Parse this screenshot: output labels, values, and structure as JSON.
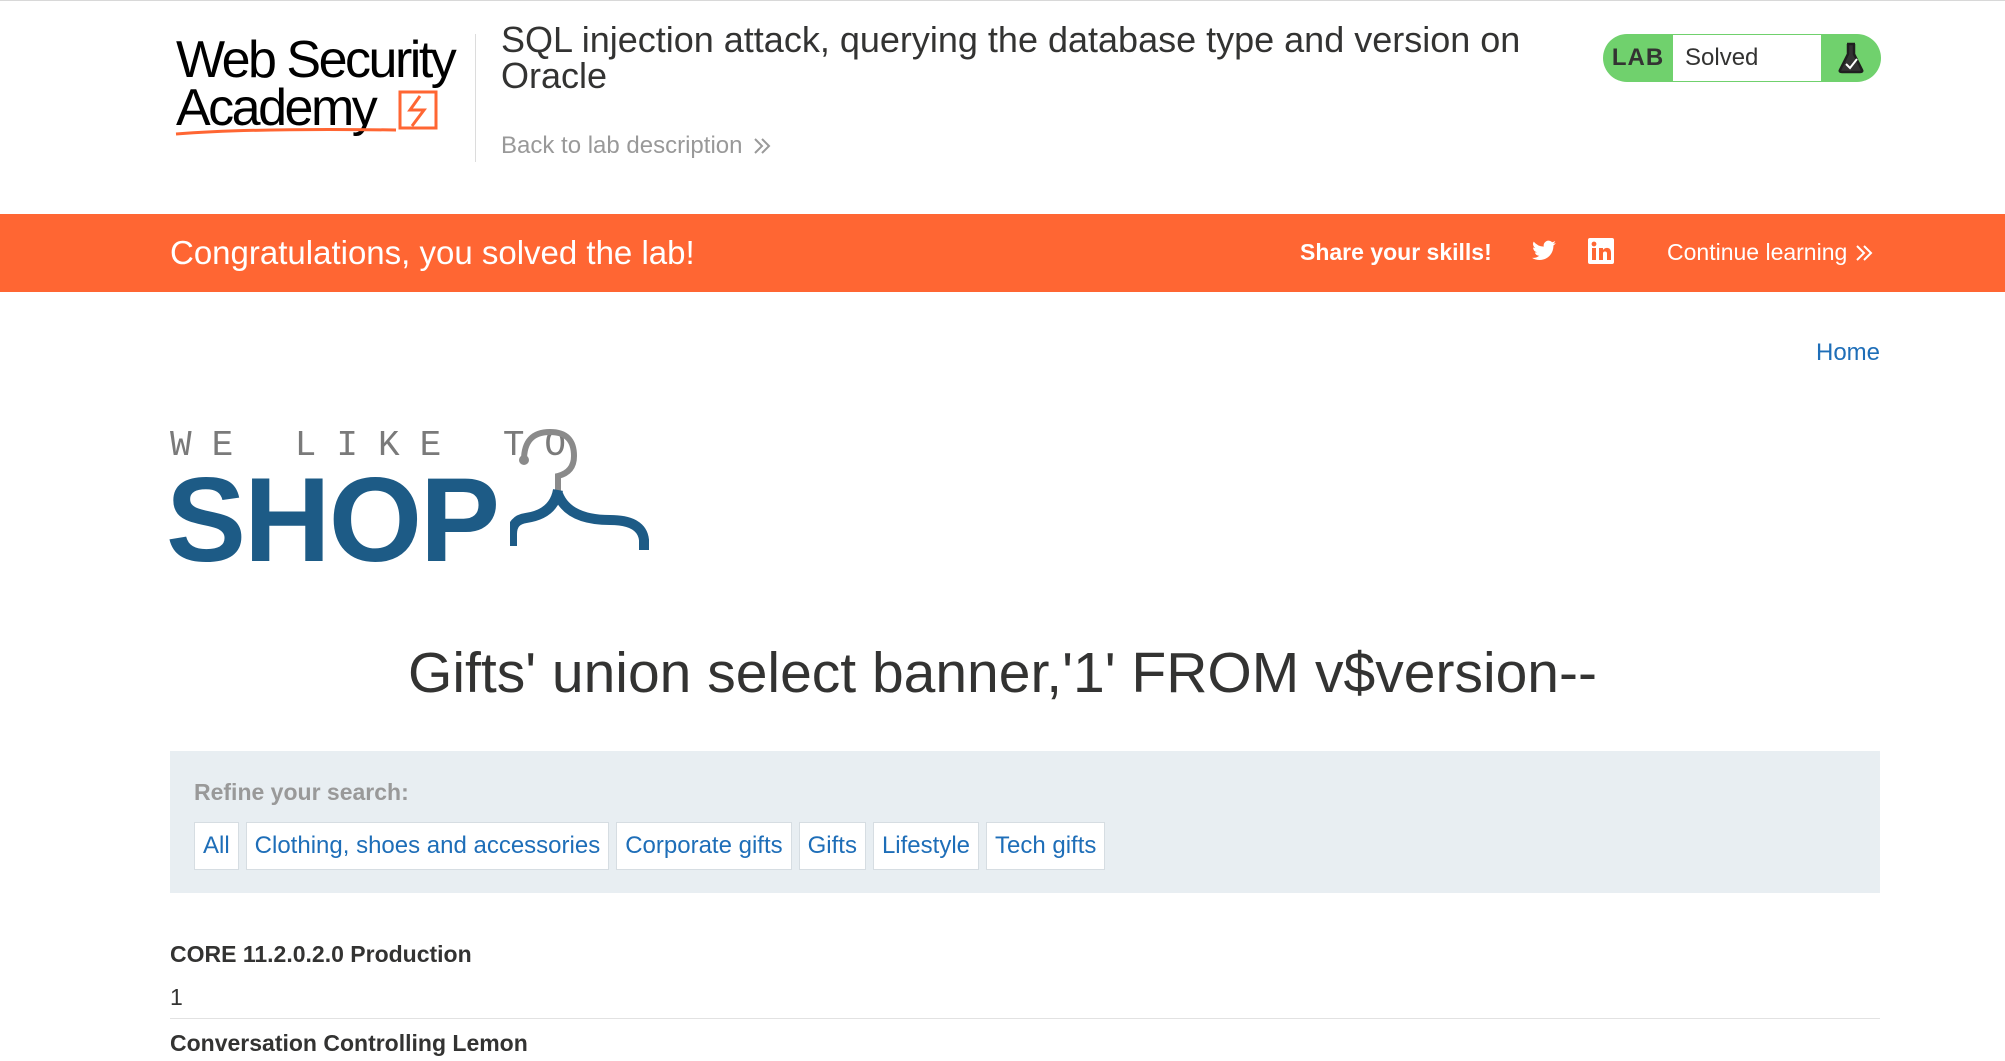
{
  "header": {
    "logo_line1": "Web Security",
    "logo_line2": "Academy",
    "lab_title": "SQL injection attack, querying the database type and version on Oracle",
    "back_link": "Back to lab description",
    "status_label": "LAB",
    "status_value": "Solved"
  },
  "banner": {
    "message": "Congratulations, you solved the lab!",
    "share": "Share your skills!",
    "continue": "Continue learning"
  },
  "nav": {
    "home": "Home"
  },
  "shop_logo": {
    "tagline": "WE LIKE TO",
    "name": "SHOP"
  },
  "search": {
    "heading": "Gifts' union select banner,'1' FROM v$version--"
  },
  "filters": {
    "label": "Refine your search:",
    "items": [
      "All",
      "Clothing, shoes and accessories",
      "Corporate gifts",
      "Gifts",
      "Lifestyle",
      "Tech gifts"
    ]
  },
  "results": [
    {
      "title": "CORE 11.2.0.2.0 Production",
      "detail": "1"
    },
    {
      "title": "Conversation Controlling Lemon",
      "detail": ""
    }
  ],
  "colors": {
    "accent_orange": "#ff6633",
    "solved_green": "#70d16d",
    "link_blue": "#1e6eb8",
    "shop_blue": "#1d5b86"
  }
}
